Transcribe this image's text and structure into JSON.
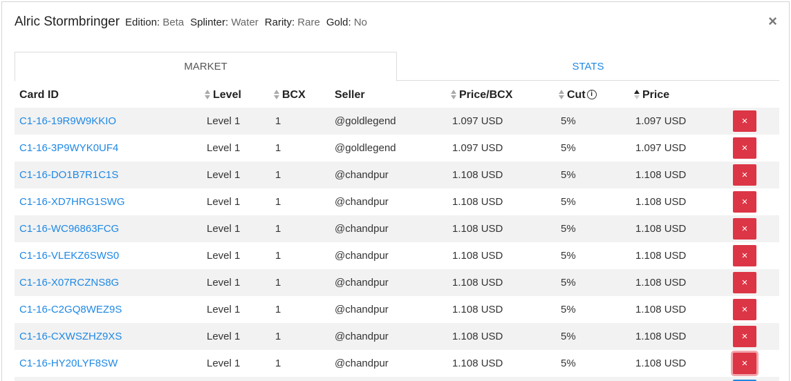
{
  "card": {
    "name": "Alric Stormbringer",
    "edition_label": "Edition:",
    "edition": "Beta",
    "splinter_label": "Splinter:",
    "splinter": "Water",
    "rarity_label": "Rarity:",
    "rarity": "Rare",
    "gold_label": "Gold:",
    "gold": "No"
  },
  "close_glyph": "×",
  "tabs": [
    {
      "label": "MARKET",
      "active": true
    },
    {
      "label": "STATS",
      "active": false
    }
  ],
  "columns": {
    "card_id": "Card ID",
    "level": "Level",
    "bcx": "BCX",
    "seller": "Seller",
    "price_bcx": "Price/BCX",
    "cut": "Cut",
    "price": "Price"
  },
  "info_glyph": "i",
  "delete_glyph": "×",
  "rows": [
    {
      "card_id": "C1-16-19R9W9KKIO",
      "level": "Level 1",
      "bcx": "1",
      "seller": "@goldlegend",
      "price_bcx": "1.097 USD",
      "cut": "5%",
      "price": "1.097 USD"
    },
    {
      "card_id": "C1-16-3P9WYK0UF4",
      "level": "Level 1",
      "bcx": "1",
      "seller": "@goldlegend",
      "price_bcx": "1.097 USD",
      "cut": "5%",
      "price": "1.097 USD"
    },
    {
      "card_id": "C1-16-DO1B7R1C1S",
      "level": "Level 1",
      "bcx": "1",
      "seller": "@chandpur",
      "price_bcx": "1.108 USD",
      "cut": "5%",
      "price": "1.108 USD"
    },
    {
      "card_id": "C1-16-XD7HRG1SWG",
      "level": "Level 1",
      "bcx": "1",
      "seller": "@chandpur",
      "price_bcx": "1.108 USD",
      "cut": "5%",
      "price": "1.108 USD"
    },
    {
      "card_id": "C1-16-WC96863FCG",
      "level": "Level 1",
      "bcx": "1",
      "seller": "@chandpur",
      "price_bcx": "1.108 USD",
      "cut": "5%",
      "price": "1.108 USD"
    },
    {
      "card_id": "C1-16-VLEKZ6SWS0",
      "level": "Level 1",
      "bcx": "1",
      "seller": "@chandpur",
      "price_bcx": "1.108 USD",
      "cut": "5%",
      "price": "1.108 USD"
    },
    {
      "card_id": "C1-16-X07RCZNS8G",
      "level": "Level 1",
      "bcx": "1",
      "seller": "@chandpur",
      "price_bcx": "1.108 USD",
      "cut": "5%",
      "price": "1.108 USD"
    },
    {
      "card_id": "C1-16-C2GQ8WEZ9S",
      "level": "Level 1",
      "bcx": "1",
      "seller": "@chandpur",
      "price_bcx": "1.108 USD",
      "cut": "5%",
      "price": "1.108 USD"
    },
    {
      "card_id": "C1-16-CXWSZHZ9XS",
      "level": "Level 1",
      "bcx": "1",
      "seller": "@chandpur",
      "price_bcx": "1.108 USD",
      "cut": "5%",
      "price": "1.108 USD"
    },
    {
      "card_id": "C1-16-HY20LYF8SW",
      "level": "Level 1",
      "bcx": "1",
      "seller": "@chandpur",
      "price_bcx": "1.108 USD",
      "cut": "5%",
      "price": "1.108 USD"
    }
  ],
  "colors": {
    "link": "#1e88e5",
    "delete_button": "#dc3545",
    "row_stripe": "#f2f2f2"
  }
}
